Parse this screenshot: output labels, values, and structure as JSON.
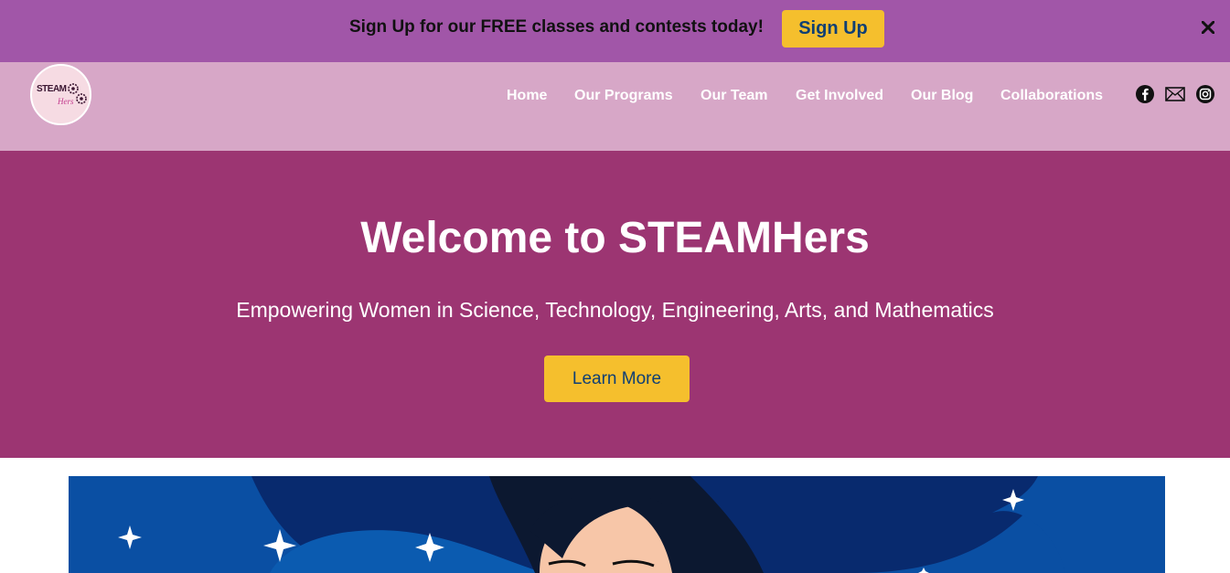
{
  "banner": {
    "text": "Sign Up for our FREE classes and contests today!",
    "signup_label": "Sign Up",
    "close_icon": "close-icon"
  },
  "brand": {
    "logo_text": "STEAM",
    "logo_script": "Hers"
  },
  "nav": {
    "items": [
      {
        "label": "Home"
      },
      {
        "label": "Our Programs"
      },
      {
        "label": "Our Team"
      },
      {
        "label": "Get Involved"
      },
      {
        "label": "Our Blog"
      },
      {
        "label": "Collaborations"
      }
    ],
    "social_icons": [
      "facebook-icon",
      "email-icon",
      "instagram-icon"
    ]
  },
  "hero": {
    "title": "Welcome to STEAMHers",
    "subtitle": "Empowering Women in Science, Technology, Engineering, Arts, and Mathematics",
    "cta_label": "Learn More"
  },
  "colors": {
    "banner_bg": "#a156a8",
    "nav_bg": "#d7a7c7",
    "hero_bg": "#9c3572",
    "accent_yellow": "#f5bf2d",
    "button_text": "#0f3f74",
    "illustration_blue": "#0a4fa3"
  }
}
